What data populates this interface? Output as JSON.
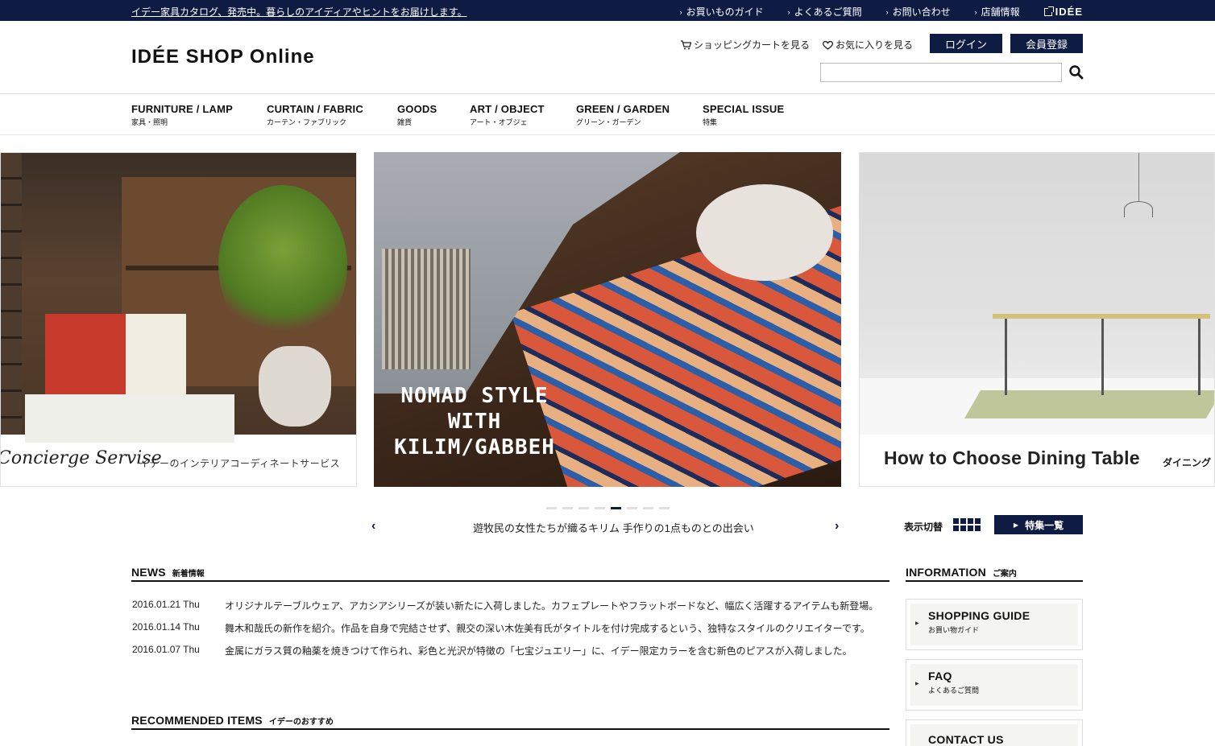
{
  "topbar": {
    "announcement": "イデー家具カタログ、発売中。暮らしのアイディアやヒントをお届けします。",
    "links": [
      "お買いものガイド",
      "よくあるご質問",
      "お問い合わせ",
      "店舗情報"
    ],
    "brand": "IDÉE"
  },
  "header": {
    "logo": "IDÉE SHOP Online",
    "cart_label": "ショッピングカートを見る",
    "favorites_label": "お気に入りを見る",
    "login_label": "ログイン",
    "register_label": "会員登録",
    "search_placeholder": ""
  },
  "nav": [
    {
      "en": "FURNITURE / LAMP",
      "ja": "家具・照明"
    },
    {
      "en": "CURTAIN / FABRIC",
      "ja": "カーテン・ファブリック"
    },
    {
      "en": "GOODS",
      "ja": "雑貨"
    },
    {
      "en": "ART / OBJECT",
      "ja": "アート・オブジェ"
    },
    {
      "en": "GREEN / GARDEN",
      "ja": "グリーン・ガーデン"
    },
    {
      "en": "SPECIAL ISSUE",
      "ja": "特集"
    }
  ],
  "slides": {
    "left": {
      "caption": "Concierge Servise",
      "caption_ja": "イデーのインテリアコーディネートサービス"
    },
    "center": {
      "title_lines": [
        "NOMAD STYLE",
        "WITH",
        "KILIM/GABBEH"
      ]
    },
    "right": {
      "caption": "How to Choose Dining Table",
      "caption_ja": "ダイニング"
    }
  },
  "slider": {
    "dot_count": 8,
    "active_index": 4,
    "caption": "遊牧民の女性たちが織るキリム 手作りの1点ものとの出会い",
    "view_switch_label": "表示切替",
    "feature_list_label": "特集一覧"
  },
  "news": {
    "title": "NEWS",
    "title_ja": "新着情報",
    "items": [
      {
        "date": "2016.01.21 Thu",
        "text": "オリジナルテーブルウェア、アカシアシリーズが装い新たに入荷しました。カフェプレートやフラットボードなど、幅広く活躍するアイテムも新登場。"
      },
      {
        "date": "2016.01.14 Thu",
        "text": "舞木和哉氏の新作を紹介。作品を自身で完結させず、親交の深い木佐美有氏がタイトルを付け完成するという、独特なスタイルのクリエイターです。"
      },
      {
        "date": "2016.01.07 Thu",
        "text": "金属にガラス質の釉薬を焼きつけて作られ、彩色と光沢が特徴の「七宝ジュエリー」に、イデー限定カラーを含む新色のピアスが入荷しました。"
      }
    ]
  },
  "recommended": {
    "title": "RECOMMENDED ITEMS",
    "title_ja": "イデーのおすすめ"
  },
  "information": {
    "title": "INFORMATION",
    "title_ja": "ご案内",
    "items": [
      {
        "en": "SHOPPING GUIDE",
        "ja": "お買い物ガイド"
      },
      {
        "en": "FAQ",
        "ja": "よくあるご質問"
      },
      {
        "en": "CONTACT US",
        "ja": ""
      }
    ]
  },
  "colors": {
    "navy": "#0e1b42"
  }
}
